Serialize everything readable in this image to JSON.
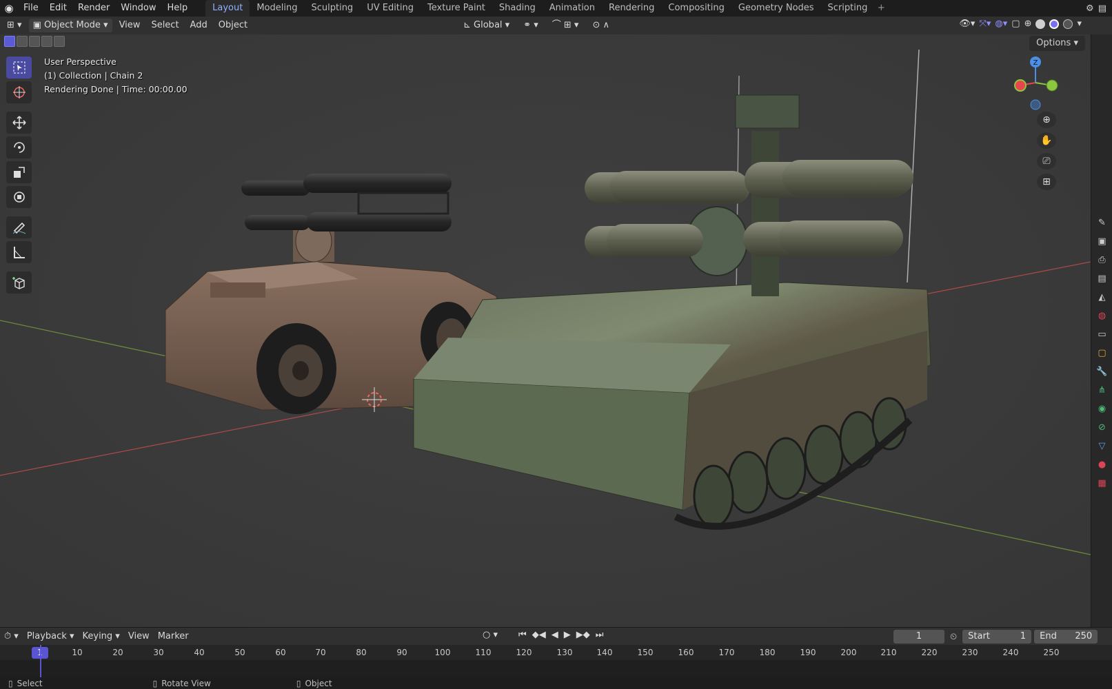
{
  "menubar": {
    "items": [
      "File",
      "Edit",
      "Render",
      "Window",
      "Help"
    ],
    "workspaces": [
      "Layout",
      "Modeling",
      "Sculpting",
      "UV Editing",
      "Texture Paint",
      "Shading",
      "Animation",
      "Rendering",
      "Compositing",
      "Geometry Nodes",
      "Scripting"
    ],
    "active_workspace": "Layout",
    "add_tab": "+"
  },
  "viewport_header": {
    "mode": "Object Mode",
    "menus": [
      "View",
      "Select",
      "Add",
      "Object"
    ],
    "transform_orientation": "Global",
    "options": "Options"
  },
  "overlay": {
    "line1": "User Perspective",
    "line2": "(1) Collection | Chain 2",
    "line3": "Rendering Done | Time: 00:00.00"
  },
  "gizmo": {
    "z_label": "Z",
    "colors": {
      "x": "#e8454c",
      "y": "#8dc63f",
      "z": "#4c8fe8"
    }
  },
  "timeline": {
    "menus": [
      "Playback",
      "Keying",
      "View",
      "Marker"
    ],
    "current_frame": "1",
    "start_label": "Start",
    "start_value": "1",
    "end_label": "End",
    "end_value": "250",
    "ticks": [
      "1",
      "10",
      "20",
      "30",
      "40",
      "50",
      "60",
      "70",
      "80",
      "90",
      "100",
      "110",
      "120",
      "130",
      "140",
      "150",
      "160",
      "170",
      "180",
      "190",
      "200",
      "210",
      "220",
      "230",
      "240",
      "250"
    ]
  },
  "status_bar": {
    "items": [
      "Select",
      "Rotate View",
      "Object"
    ]
  },
  "colors": {
    "accent": "#5a55d2",
    "active_tab_text": "#8fb0ff",
    "viewport_bg": "#3b3b3b"
  }
}
